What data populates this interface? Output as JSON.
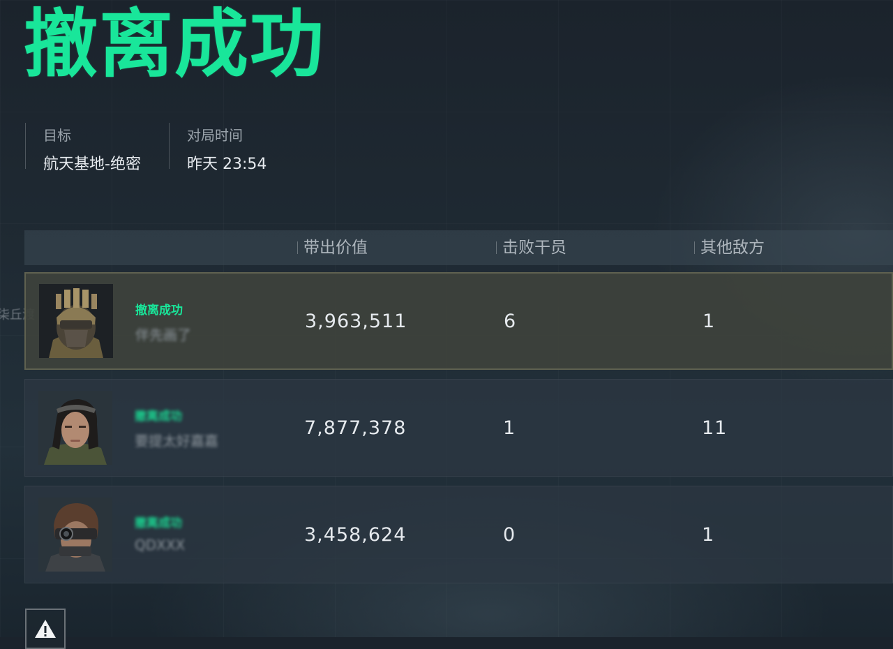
{
  "title": "撤离成功",
  "info": {
    "target": {
      "label": "目标",
      "value": "航天基地-绝密"
    },
    "time": {
      "label": "对局时间",
      "value": "昨天 23:54"
    }
  },
  "side_text": "柒丘渡",
  "table": {
    "columns": [
      "带出价值",
      "击败干员",
      "其他敌方"
    ],
    "rows": [
      {
        "status": "撤离成功",
        "player": "伴先画了",
        "avatar": "helmet-operator-avatar",
        "value": "3,963,511",
        "kills": "6",
        "others": "1"
      },
      {
        "status": "撤离成功",
        "player": "要提太好嘉嘉",
        "avatar": "female-operator-avatar",
        "value": "7,877,378",
        "kills": "1",
        "others": "11"
      },
      {
        "status": "撤离成功",
        "player": "QDXXX",
        "avatar": "goggles-operator-avatar",
        "value": "3,458,624",
        "kills": "0",
        "others": "1"
      }
    ]
  },
  "colors": {
    "accent": "#19e69a",
    "highlight_row": "#3e423c"
  },
  "icons": {
    "warning": "warning-icon"
  }
}
